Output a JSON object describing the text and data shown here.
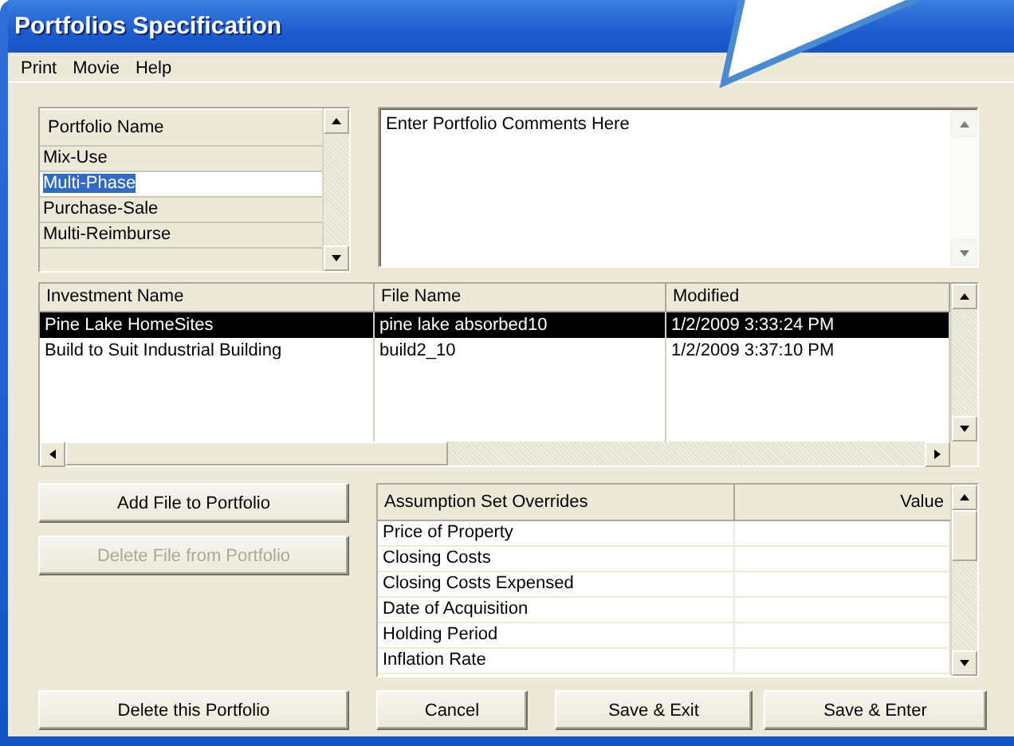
{
  "window": {
    "title": "Portfolios Specification"
  },
  "menu": [
    {
      "label": "Print"
    },
    {
      "label": "Movie"
    },
    {
      "label": "Help"
    }
  ],
  "portfolio_list": {
    "header": "Portfolio Name",
    "items": [
      {
        "label": "Mix-Use",
        "selected": false
      },
      {
        "label": "Multi-Phase",
        "selected": true
      },
      {
        "label": "Purchase-Sale",
        "selected": false
      },
      {
        "label": "Multi-Reimburse",
        "selected": false
      }
    ]
  },
  "comments": {
    "value": "Enter Portfolio Comments Here"
  },
  "investments": {
    "columns": [
      "Investment Name",
      "File Name",
      "Modified"
    ],
    "rows": [
      {
        "cells": [
          "Pine Lake HomeSites",
          "pine lake absorbed10",
          "1/2/2009 3:33:24 PM"
        ],
        "selected": true
      },
      {
        "cells": [
          "Build to Suit Industrial Building",
          "build2_10",
          "1/2/2009 3:37:10 PM"
        ],
        "selected": false
      }
    ]
  },
  "side_buttons": [
    {
      "label": "Add File to Portfolio",
      "disabled": false
    },
    {
      "label": "Delete File from Portfolio",
      "disabled": true
    }
  ],
  "overrides": {
    "columns": [
      "Assumption Set Overrides",
      "Value"
    ],
    "rows": [
      {
        "cells": [
          "Price of Property"
        ]
      },
      {
        "cells": [
          "Closing Costs"
        ]
      },
      {
        "cells": [
          "Closing Costs Expensed"
        ]
      },
      {
        "cells": [
          "Date of Acquisition"
        ]
      },
      {
        "cells": [
          "Holding Period"
        ]
      },
      {
        "cells": [
          "Inflation Rate"
        ]
      }
    ]
  },
  "footer_buttons": [
    {
      "label": "Delete this Portfolio",
      "disabled": false
    },
    {
      "label": "Cancel",
      "disabled": false
    },
    {
      "label": "Save & Exit",
      "disabled": false
    },
    {
      "label": "Save & Enter",
      "disabled": false
    }
  ]
}
